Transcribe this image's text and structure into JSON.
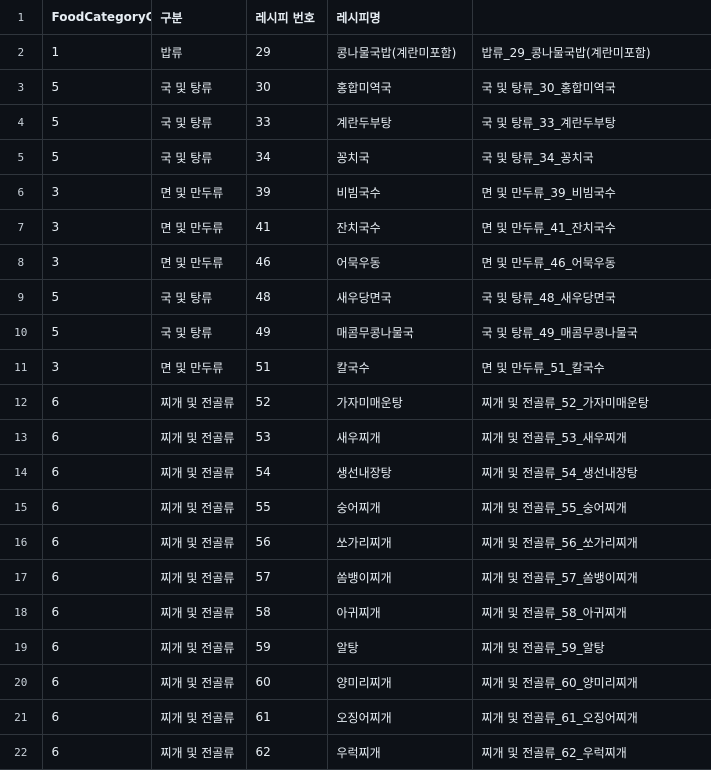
{
  "table": {
    "header_row_number": "1",
    "headers": [
      "FoodCategoryCd",
      "구분",
      "레시피 번호",
      "레시피명",
      ""
    ],
    "rows": [
      {
        "n": "2",
        "cells": [
          "1",
          "밥류",
          "29",
          "콩나물국밥(계란미포함)",
          "밥류_29_콩나물국밥(계란미포함)"
        ]
      },
      {
        "n": "3",
        "cells": [
          "5",
          "국 및 탕류",
          "30",
          "홍합미역국",
          "국 및 탕류_30_홍합미역국"
        ]
      },
      {
        "n": "4",
        "cells": [
          "5",
          "국 및 탕류",
          "33",
          "계란두부탕",
          "국 및 탕류_33_계란두부탕"
        ]
      },
      {
        "n": "5",
        "cells": [
          "5",
          "국 및 탕류",
          "34",
          "꽁치국",
          "국 및 탕류_34_꽁치국"
        ]
      },
      {
        "n": "6",
        "cells": [
          "3",
          "면 및 만두류",
          "39",
          "비빔국수",
          "면 및 만두류_39_비빔국수"
        ]
      },
      {
        "n": "7",
        "cells": [
          "3",
          "면 및 만두류",
          "41",
          "잔치국수",
          "면 및 만두류_41_잔치국수"
        ]
      },
      {
        "n": "8",
        "cells": [
          "3",
          "면 및 만두류",
          "46",
          "어묵우동",
          "면 및 만두류_46_어묵우동"
        ]
      },
      {
        "n": "9",
        "cells": [
          "5",
          "국 및 탕류",
          "48",
          "새우당면국",
          "국 및 탕류_48_새우당면국"
        ]
      },
      {
        "n": "10",
        "cells": [
          "5",
          "국 및 탕류",
          "49",
          "매콤무콩나물국",
          "국 및 탕류_49_매콤무콩나물국"
        ]
      },
      {
        "n": "11",
        "cells": [
          "3",
          "면 및 만두류",
          "51",
          "칼국수",
          "면 및 만두류_51_칼국수"
        ]
      },
      {
        "n": "12",
        "cells": [
          "6",
          "찌개 및 전골류",
          "52",
          "가자미매운탕",
          "찌개 및 전골류_52_가자미매운탕"
        ]
      },
      {
        "n": "13",
        "cells": [
          "6",
          "찌개 및 전골류",
          "53",
          "새우찌개",
          "찌개 및 전골류_53_새우찌개"
        ]
      },
      {
        "n": "14",
        "cells": [
          "6",
          "찌개 및 전골류",
          "54",
          "생선내장탕",
          "찌개 및 전골류_54_생선내장탕"
        ]
      },
      {
        "n": "15",
        "cells": [
          "6",
          "찌개 및 전골류",
          "55",
          "숭어찌개",
          "찌개 및 전골류_55_숭어찌개"
        ]
      },
      {
        "n": "16",
        "cells": [
          "6",
          "찌개 및 전골류",
          "56",
          "쏘가리찌개",
          "찌개 및 전골류_56_쏘가리찌개"
        ]
      },
      {
        "n": "17",
        "cells": [
          "6",
          "찌개 및 전골류",
          "57",
          "쏨뱅이찌개",
          "찌개 및 전골류_57_쏨뱅이찌개"
        ]
      },
      {
        "n": "18",
        "cells": [
          "6",
          "찌개 및 전골류",
          "58",
          "아귀찌개",
          "찌개 및 전골류_58_아귀찌개"
        ]
      },
      {
        "n": "19",
        "cells": [
          "6",
          "찌개 및 전골류",
          "59",
          "알탕",
          "찌개 및 전골류_59_알탕"
        ]
      },
      {
        "n": "20",
        "cells": [
          "6",
          "찌개 및 전골류",
          "60",
          "양미리찌개",
          "찌개 및 전골류_60_양미리찌개"
        ]
      },
      {
        "n": "21",
        "cells": [
          "6",
          "찌개 및 전골류",
          "61",
          "오징어찌개",
          "찌개 및 전골류_61_오징어찌개"
        ]
      },
      {
        "n": "22",
        "cells": [
          "6",
          "찌개 및 전골류",
          "62",
          "우럭찌개",
          "찌개 및 전골류_62_우럭찌개"
        ]
      }
    ]
  }
}
